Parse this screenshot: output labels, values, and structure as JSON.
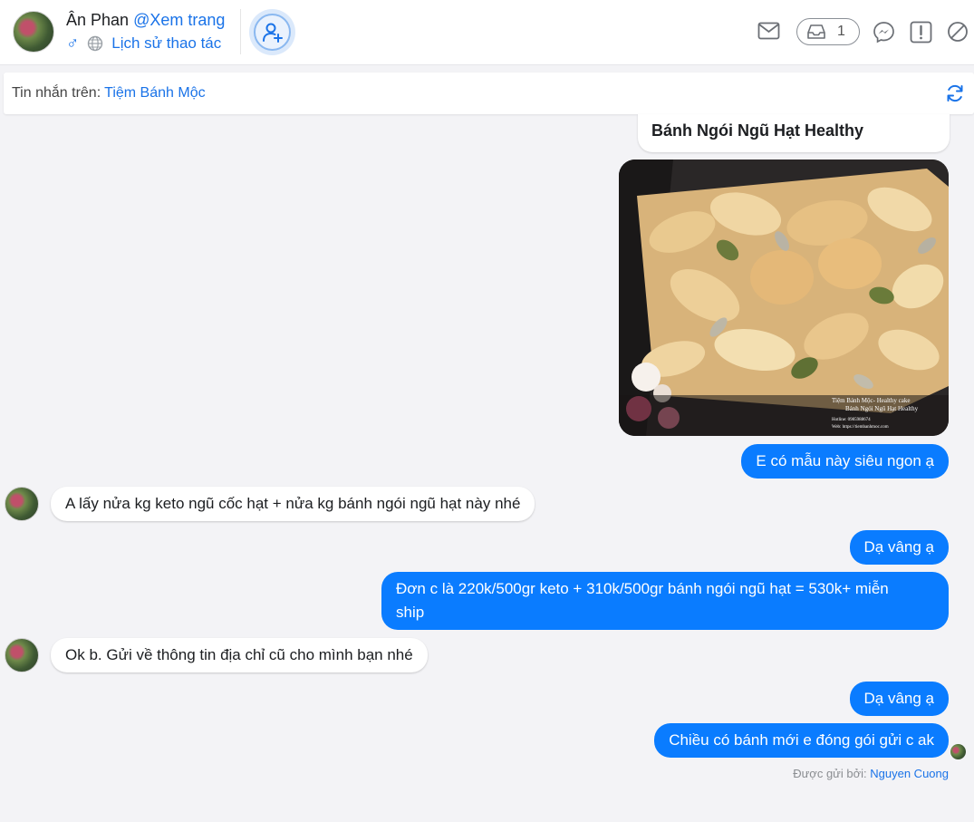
{
  "header": {
    "customer_name": "Ân Phan",
    "view_page_link": "@Xem trang",
    "gender_symbol": "♂",
    "history_link": "Lịch sử thao tác",
    "inbox_count": "1",
    "icons": [
      "globe-icon",
      "add-friend-icon",
      "mail-icon",
      "inbox-icon",
      "messenger-icon",
      "report-icon",
      "block-icon"
    ]
  },
  "topbar": {
    "label": "Tin nhắn trên:",
    "page_name": "Tiệm Bánh Mộc",
    "icon": "refresh-icon"
  },
  "conversation": {
    "card_title": "Bánh Ngói Ngũ Hạt Healthy",
    "photo_caption": {
      "line1": "Tiệm Bánh Mộc- Healthy cake",
      "line2": "Bánh Ngói Ngũ Hạt Healthy",
      "line3": "Hotline: 0985988674",
      "line4": "Web: https://tiembanhmoc.com"
    },
    "messages": [
      {
        "from": "page",
        "text": "E có mẫu này siêu ngon ạ"
      },
      {
        "from": "customer",
        "text": "A lấy nửa kg keto ngũ cốc hạt + nửa kg bánh ngói ngũ hạt này nhé"
      },
      {
        "from": "page",
        "text": "Dạ vâng ạ"
      },
      {
        "from": "page",
        "text_line1": "Đơn c là 220k/500gr keto + 310k/500gr bánh ngói ngũ hạt = 530k+ miễn",
        "text_line2": "ship"
      },
      {
        "from": "customer",
        "text": "Ok b. Gửi về thông tin địa chỉ cũ cho mình bạn nhé"
      },
      {
        "from": "page",
        "text": "Dạ vâng ạ"
      },
      {
        "from": "page",
        "text": "Chiều có bánh mới e đóng gói gửi c ak"
      }
    ],
    "sent_by_label": "Được gửi bởi:",
    "sent_by_name": "Nguyen Cuong"
  },
  "colors": {
    "outgoing_bubble": "#0a7cff",
    "link": "#1a73e8",
    "background": "#f3f3f6"
  }
}
